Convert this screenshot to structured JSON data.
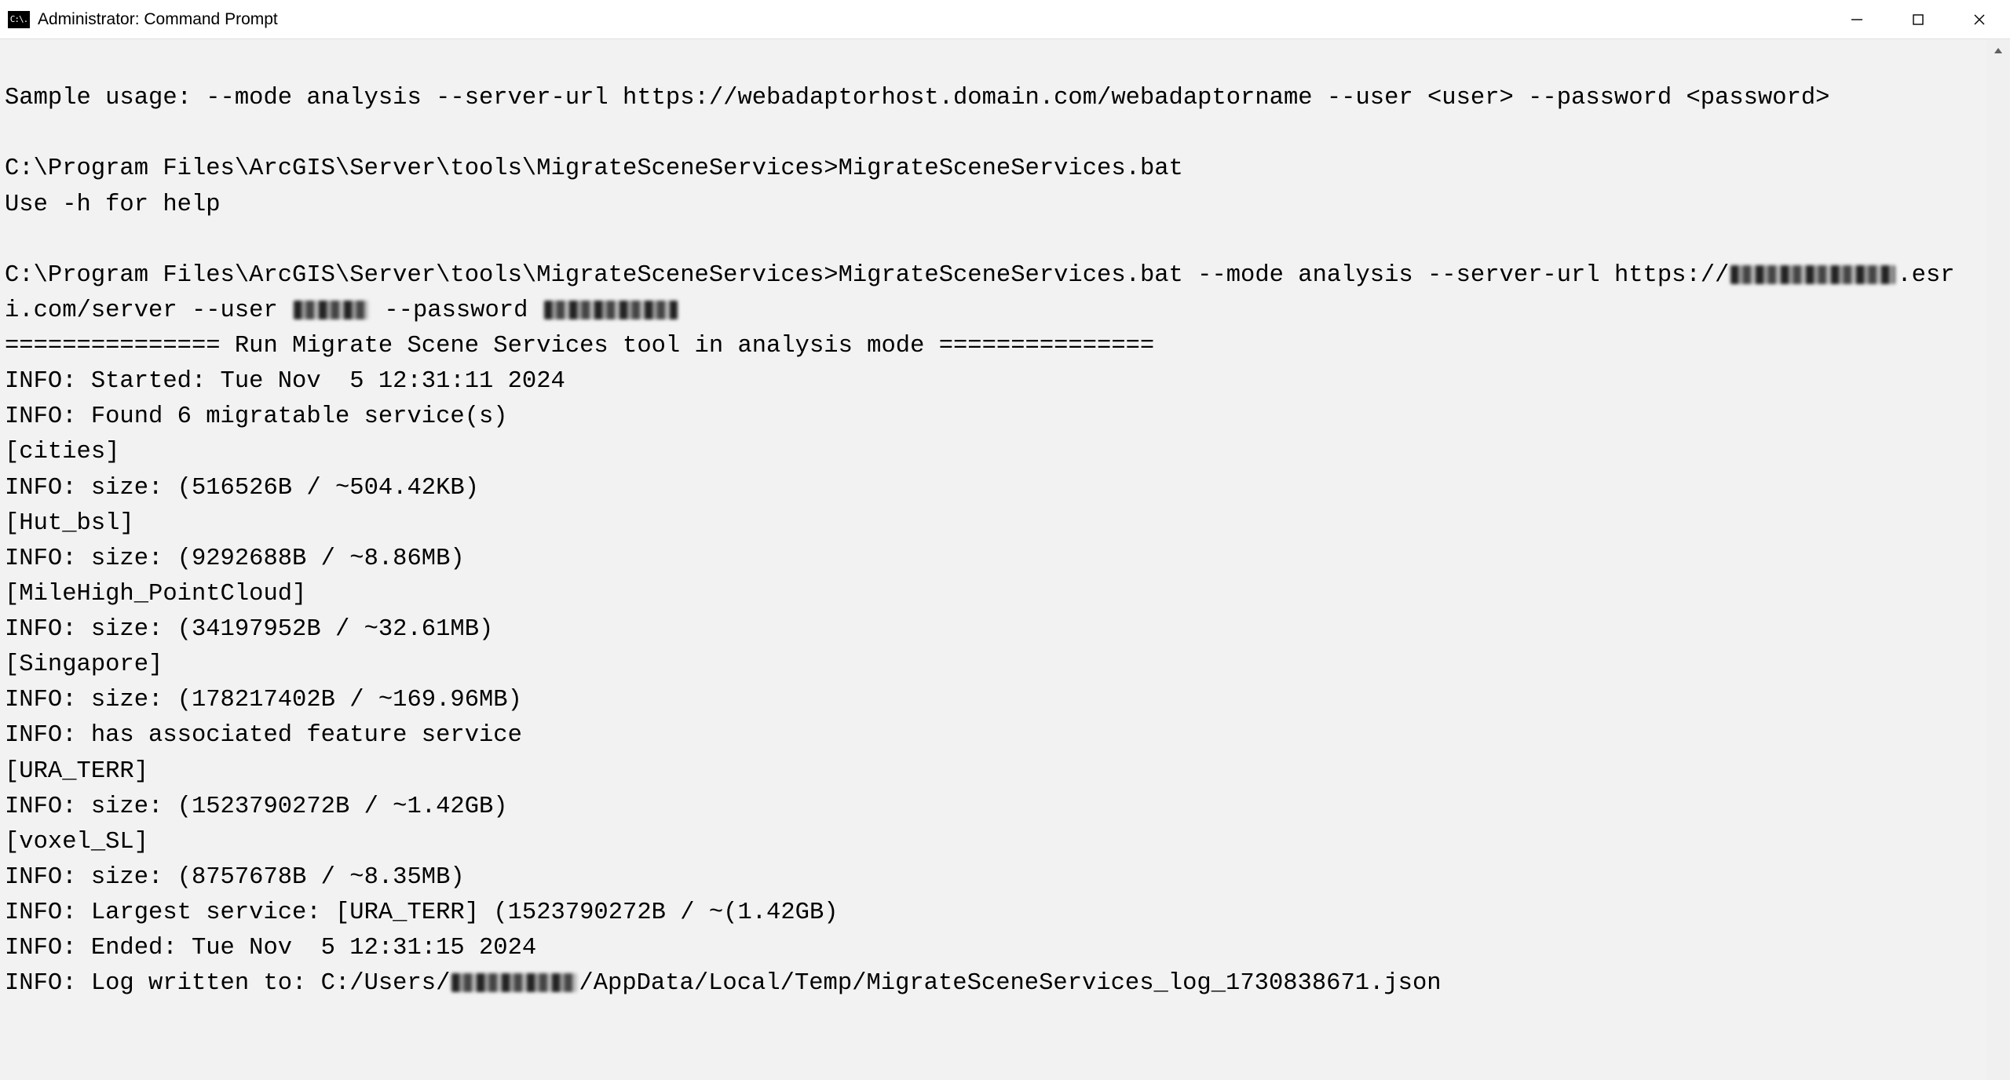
{
  "window": {
    "title": "Administrator: Command Prompt",
    "icon_label": "C:\\."
  },
  "terminal": {
    "sample_usage": "Sample usage: --mode analysis --server-url https://webadaptorhost.domain.com/webadaptorname --user <user> --password <password>",
    "prompt1_path": "C:\\Program Files\\ArcGIS\\Server\\tools\\MigrateSceneServices>",
    "prompt1_cmd": "MigrateSceneServices.bat",
    "help_hint": "Use -h for help",
    "prompt2_path": "C:\\Program Files\\ArcGIS\\Server\\tools\\MigrateSceneServices>",
    "prompt2_cmd_prefix": "MigrateSceneServices.bat --mode analysis --server-url https://",
    "prompt2_host_suffix": ".esri.com/server --user ",
    "prompt2_pw_prefix": " --password ",
    "divider": "=============== Run Migrate Scene Services tool in analysis mode ===============",
    "started": "INFO: Started: Tue Nov  5 12:31:11 2024",
    "found": "INFO: Found 6 migratable service(s)",
    "services": [
      {
        "name": "[cities]",
        "size": "INFO: size: (516526B / ~504.42KB)"
      },
      {
        "name": "[Hut_bsl]",
        "size": "INFO: size: (9292688B / ~8.86MB)"
      },
      {
        "name": "[MileHigh_PointCloud]",
        "size": "INFO: size: (34197952B / ~32.61MB)"
      },
      {
        "name": "[Singapore]",
        "size": "INFO: size: (178217402B / ~169.96MB)",
        "extra": "INFO: has associated feature service"
      },
      {
        "name": "[URA_TERR]",
        "size": "INFO: size: (1523790272B / ~1.42GB)"
      },
      {
        "name": "[voxel_SL]",
        "size": "INFO: size: (8757678B / ~8.35MB)"
      }
    ],
    "largest": "INFO: Largest service: [URA_TERR] (1523790272B / ~(1.42GB)",
    "ended": "INFO: Ended: Tue Nov  5 12:31:15 2024",
    "log_prefix": "INFO: Log written to: C:/Users/",
    "log_suffix": "/AppData/Local/Temp/MigrateSceneServices_log_1730838671.json"
  }
}
